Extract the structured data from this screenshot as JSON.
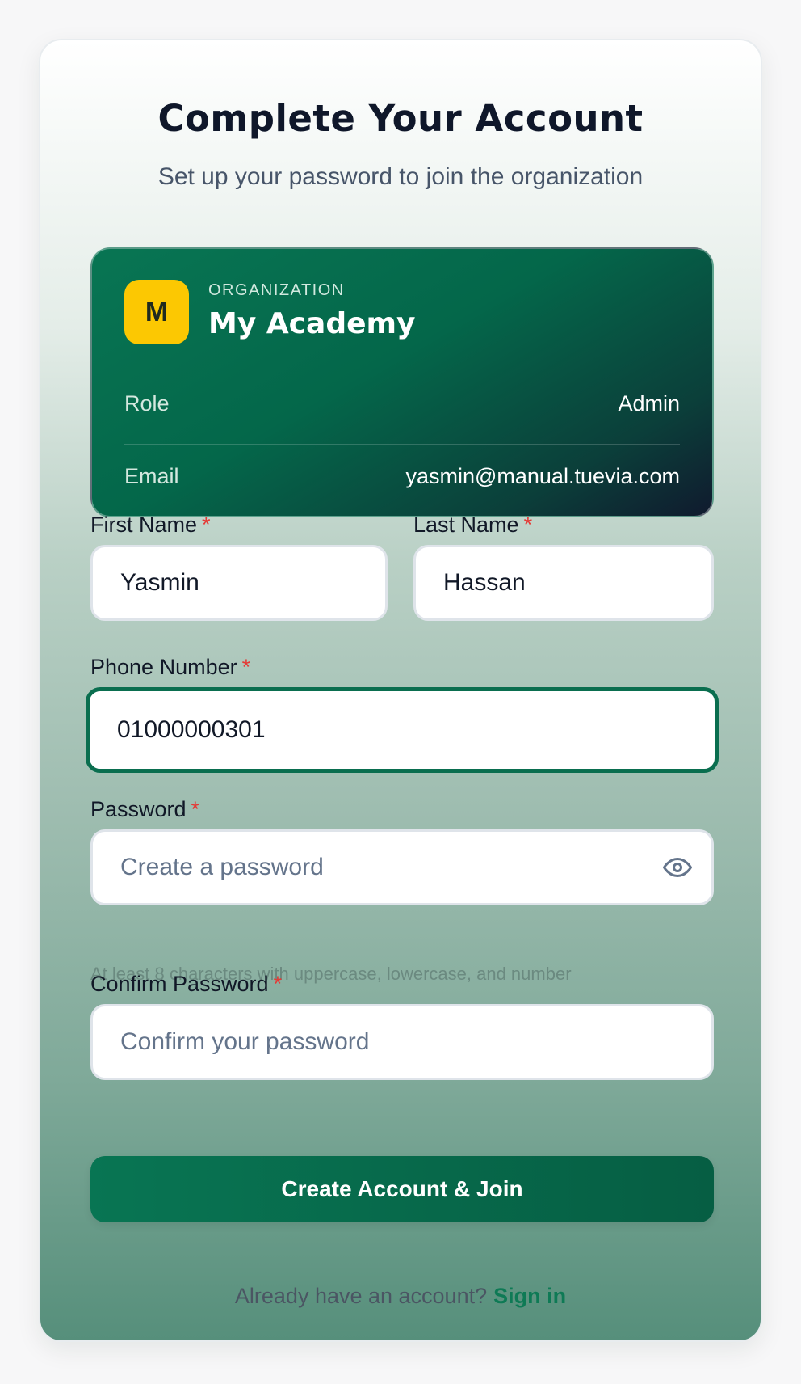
{
  "header": {
    "title": "Complete Your Account",
    "subtitle": "Set up your password to join the organization"
  },
  "organization": {
    "logo_letter": "M",
    "label": "ORGANIZATION",
    "name": "My Academy",
    "role_label": "Role",
    "role_value": "Admin",
    "email_label": "Email",
    "email_value": "yasmin@manual.tuevia.com"
  },
  "form": {
    "first_name": {
      "label": "First Name",
      "required": "*",
      "value": "Yasmin"
    },
    "last_name": {
      "label": "Last Name",
      "required": "*",
      "value": "Hassan"
    },
    "phone": {
      "label": "Phone Number",
      "required": "*",
      "value": "01000000301"
    },
    "password": {
      "label": "Password",
      "required": "*",
      "placeholder": "Create a password",
      "hint": "At least 8 characters with uppercase, lowercase, and number"
    },
    "confirm_password": {
      "label": "Confirm Password",
      "required": "*",
      "placeholder": "Confirm your password"
    },
    "submit_label": "Create Account & Join"
  },
  "footer": {
    "prompt": "Already have an account?",
    "link": "Sign in"
  },
  "colors": {
    "brand": "#087553",
    "accent": "#fcc802",
    "required": "#e53935"
  },
  "icons": {
    "password_toggle": "eye-icon"
  }
}
